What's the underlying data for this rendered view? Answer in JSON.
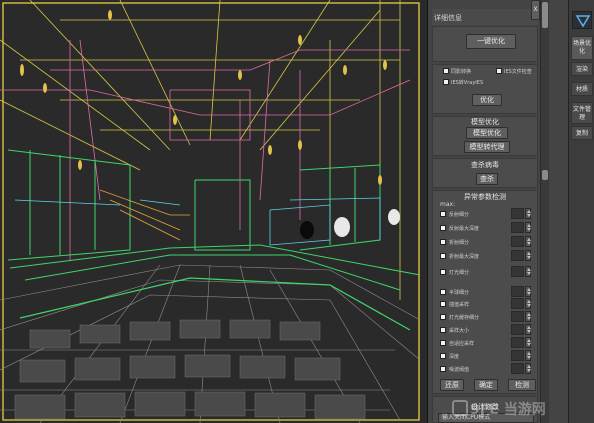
{
  "panel": {
    "details_title": "详细信息",
    "one_click_optimize": "一键优化",
    "options": [
      {
        "label": "同影转换",
        "checked": false
      },
      {
        "label": "IES文件检查",
        "checked": false
      },
      {
        "label": "IES转VrayIES",
        "checked": false
      }
    ],
    "optimize": "优化",
    "model_optimize_title": "模型优化",
    "model_optimize_btn": "模型优化",
    "model_to_proxy_btn": "模型转代理",
    "virus_title": "查杀病毒",
    "kill_btn": "查杀",
    "anomaly_title": "异常参数检测",
    "max_label": "max:",
    "checks_top": [
      {
        "label": "反射细分"
      },
      {
        "label": "反射最大深度"
      },
      {
        "label": "折射细分"
      },
      {
        "label": "折射最大深度"
      }
    ],
    "checks_mid": [
      {
        "label": "灯光细分"
      }
    ],
    "checks_bottom": [
      {
        "label": "半球细分"
      },
      {
        "label": "插值采样"
      },
      {
        "label": "灯光缓存细分"
      },
      {
        "label": "采样大小"
      },
      {
        "label": "自适应采样"
      },
      {
        "label": "深度"
      },
      {
        "label": "噪波阈值"
      }
    ],
    "restore_btn": "还原",
    "confirm_btn": "确定",
    "detect_btn": "检测",
    "bottom_title": "设计修改",
    "bottom_input_placeholder": "输入关闭CPU模式",
    "close_button": "X"
  },
  "tabs": [
    {
      "label": "场景优化",
      "active": true
    },
    {
      "label": "渲染",
      "active": false
    },
    {
      "label": "材质",
      "active": false
    },
    {
      "label": "文件管理",
      "active": false
    },
    {
      "label": "复制",
      "active": false
    }
  ],
  "watermark": "9FE 当游网"
}
